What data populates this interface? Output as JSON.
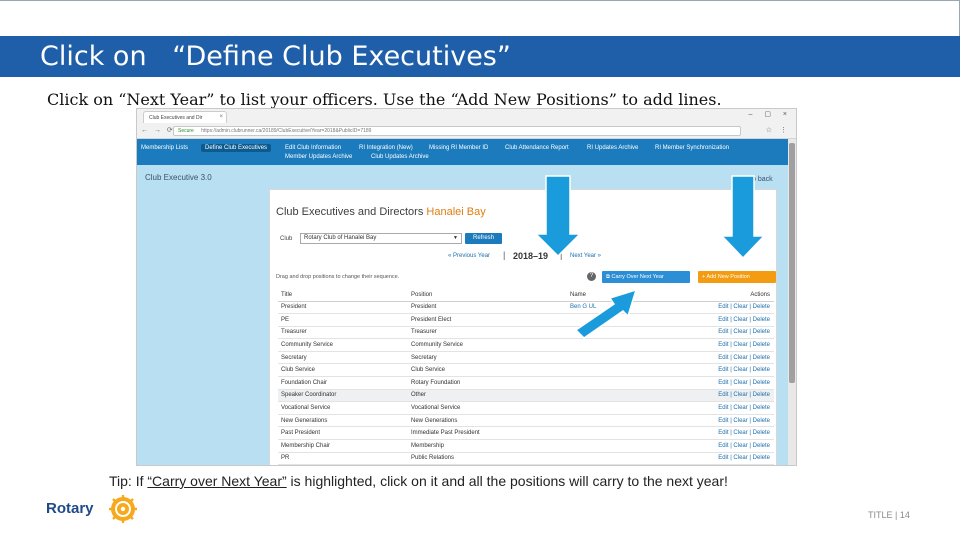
{
  "slide": {
    "title": "Click on   “Define Club Executives”",
    "instruction": "Click on “Next Year” to list your officers.  Use the “Add New Positions” to add lines.",
    "tip_prefix": "Tip: If  ",
    "tip_highlight": "“Carry over Next Year”",
    "tip_suffix": " is highlighted, click on it and all the positions will carry to the next year!",
    "footer": "TITLE | 14",
    "logo_text": "Rotary",
    "callout_color": "#1a9bdb"
  },
  "browser": {
    "tab_title": "Club Executives and Dir",
    "tab_close": "×",
    "window_controls": "– ▢ ×",
    "secure_label": "Secure",
    "url": "https://admin.clubrunner.ca/20189/ClubExecutive/Year=2018&PublicID=7189",
    "nav_icons": "← → ⟳",
    "browser_icons": "☆ ⋮"
  },
  "site_nav": {
    "items": [
      "Membership Lists",
      "Define Club Executives",
      "Edit Club Information",
      "RI Integration (New)",
      "Missing RI Member ID",
      "Club Attendance Report",
      "RI Updates Archive",
      "RI Member Synchronization",
      "Member Updates Archive",
      "Club Updates Archive"
    ]
  },
  "page": {
    "section_title": "Club Executive 3.0",
    "go_back": "Go back",
    "heading": "Club Executives and Directors",
    "heading_club": "Hanalei Bay",
    "club_label": "Club",
    "club_select_value": "Rotary Club of Hanalei Bay",
    "refresh_label": "Refresh",
    "prev_year": "« Previous Year",
    "year": "2018–19",
    "next_year": "Next Year »",
    "drag_hint": "Drag and drop positions to change their sequence.",
    "help_icon": "?",
    "carry_label": "Carry Over Next Year",
    "add_label": "Add New Position"
  },
  "table": {
    "headers": [
      "Title",
      "Position",
      "Name",
      "Actions"
    ],
    "actions_text": "Edit | Clear | Delete",
    "rows": [
      {
        "title": "President",
        "position": "President",
        "name": "Ben G UL"
      },
      {
        "title": "PE",
        "position": "President Elect",
        "name": ""
      },
      {
        "title": "Treasurer",
        "position": "Treasurer",
        "name": ""
      },
      {
        "title": "Community Service",
        "position": "Community Service",
        "name": ""
      },
      {
        "title": "Secretary",
        "position": "Secretary",
        "name": ""
      },
      {
        "title": "Club Service",
        "position": "Club Service",
        "name": ""
      },
      {
        "title": "Foundation Chair",
        "position": "Rotary Foundation",
        "name": ""
      },
      {
        "title": "Speaker Coordinator",
        "position": "Other",
        "name": ""
      },
      {
        "title": "Vocational Service",
        "position": "Vocational Service",
        "name": ""
      },
      {
        "title": "New Generations",
        "position": "New Generations",
        "name": ""
      },
      {
        "title": "Past President",
        "position": "Immediate Past President",
        "name": ""
      },
      {
        "title": "Membership Chair",
        "position": "Membership",
        "name": ""
      },
      {
        "title": "PR",
        "position": "Public Relations",
        "name": ""
      }
    ]
  }
}
